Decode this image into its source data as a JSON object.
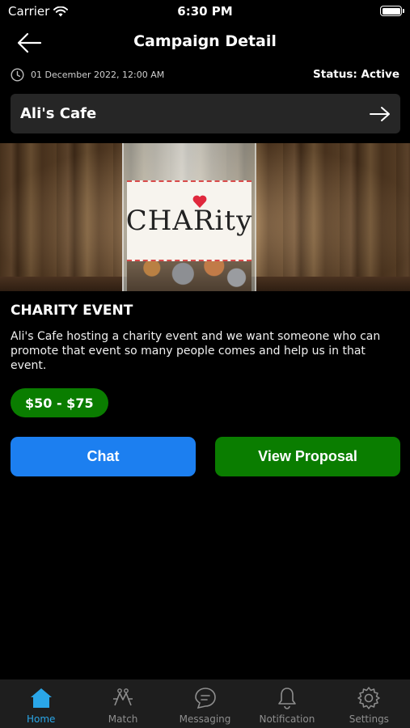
{
  "status_bar": {
    "carrier": "Carrier",
    "time": "6:30 PM"
  },
  "header": {
    "title": "Campaign Detail"
  },
  "meta": {
    "date": "01 December 2022, 12:00 AM",
    "status": "Status: Active"
  },
  "business": {
    "name": "Ali's Cafe"
  },
  "banner": {
    "jar_label": "CHARity"
  },
  "event": {
    "title": "CHARITY EVENT",
    "description": "Ali's Cafe hosting a charity event and we want someone who can promote that event so many people comes and help us in that event.",
    "price": "$50 - $75"
  },
  "actions": {
    "chat": "Chat",
    "view_proposal": "View Proposal"
  },
  "tabs": [
    {
      "label": "Home",
      "icon": "home-icon",
      "active": true
    },
    {
      "label": "Match",
      "icon": "match-icon",
      "active": false
    },
    {
      "label": "Messaging",
      "icon": "messaging-icon",
      "active": false
    },
    {
      "label": "Notification",
      "icon": "bell-icon",
      "active": false
    },
    {
      "label": "Settings",
      "icon": "gear-icon",
      "active": false
    }
  ],
  "colors": {
    "accent_blue": "#1c7ff0",
    "accent_green": "#0a7d00",
    "tab_active": "#2aa6e8"
  }
}
